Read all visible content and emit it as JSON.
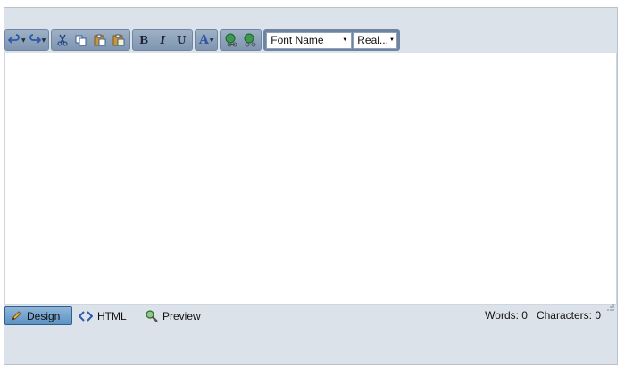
{
  "toolbar": {
    "groups": [
      {
        "name": "history",
        "buttons": [
          "undo-icon",
          "redo-icon"
        ]
      },
      {
        "name": "clipboard",
        "buttons": [
          "cut-icon",
          "copy-icon",
          "paste-icon",
          "paste-special-icon"
        ]
      },
      {
        "name": "format",
        "buttons": [
          "bold-icon",
          "italic-icon",
          "underline-icon"
        ]
      },
      {
        "name": "color",
        "buttons": [
          "font-color-icon"
        ]
      },
      {
        "name": "links",
        "buttons": [
          "insert-link-icon",
          "remove-link-icon"
        ]
      }
    ],
    "bold_label": "B",
    "italic_label": "I",
    "underline_label": "U",
    "font_color_label": "A",
    "font_name": "Font Name",
    "font_size": "Real..."
  },
  "modes": {
    "design": "Design",
    "html": "HTML",
    "preview": "Preview"
  },
  "stats": {
    "words": "Words: 0",
    "characters": "Characters: 0"
  },
  "colors": {
    "frame": "#dce2ea",
    "toolbar_group": "#8aa0bb",
    "active_tab": "#6fa0cf"
  }
}
